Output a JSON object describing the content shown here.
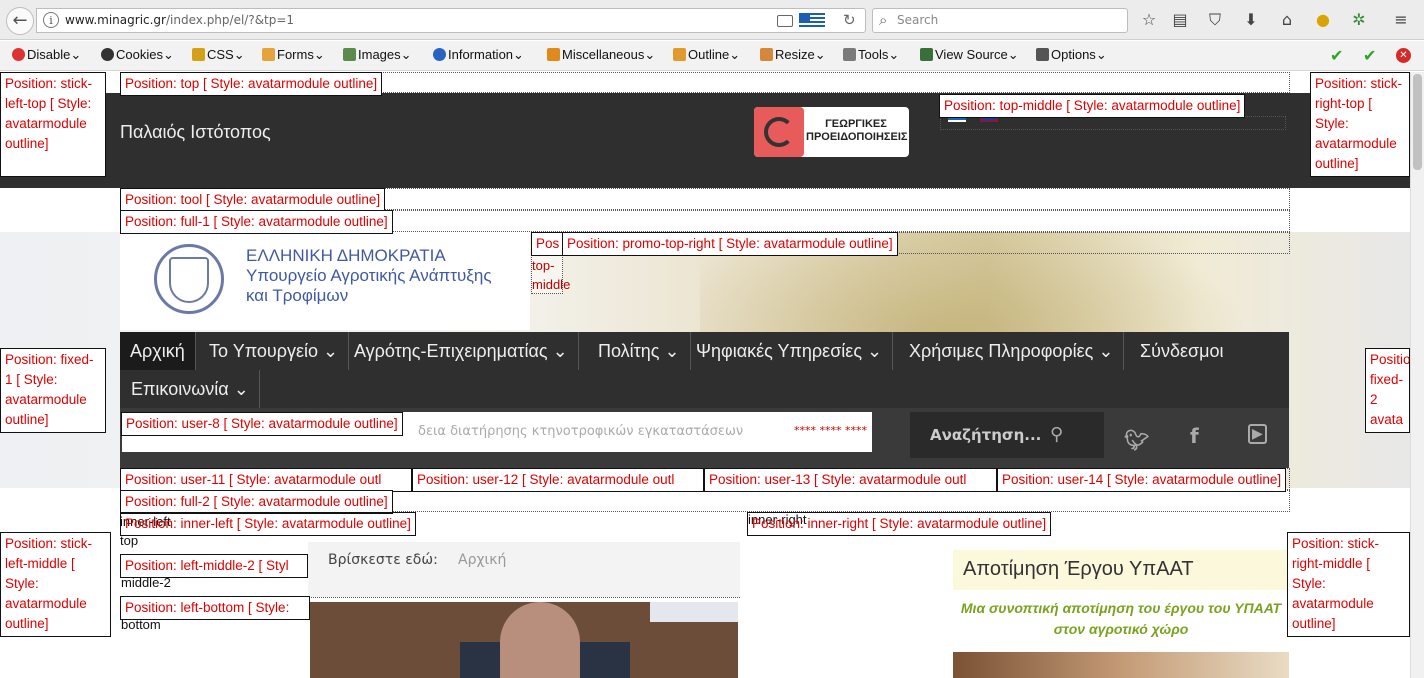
{
  "browser": {
    "url_host": "www.minagric.gr",
    "url_path": "/index.php/el/?&tp=1",
    "search_placeholder": "Search",
    "icons": [
      "back-icon",
      "info-icon",
      "reader-view-icon",
      "flag-greece-icon",
      "reload-icon",
      "search-icon",
      "bookmark-star-icon",
      "library-icon",
      "pocket-icon",
      "download-icon",
      "home-icon",
      "extension-icon",
      "extension-2-icon",
      "menu-icon"
    ]
  },
  "devbar": {
    "items": [
      "Disable",
      "Cookies",
      "CSS",
      "Forms",
      "Images",
      "Information",
      "Miscellaneous",
      "Outline",
      "Resize",
      "Tools",
      "View Source",
      "Options"
    ]
  },
  "outlines": {
    "stick_left_top": "Position: stick-left-top [ Style: avatarmodule outline]",
    "top": "Position: top [ Style: avatarmodule outline]",
    "top_middle": "Position: top-middle [ Style: avatarmodule outline]",
    "stick_right_top": "Position: stick-right-top [ Style: avatarmodule outline]",
    "tool": "Position: tool [ Style: avatarmodule outline]",
    "full_1": "Position: full-1 [ Style: avatarmodule outline]",
    "promo_top_middle_partial": "Pos",
    "promo_top_middle_rest": "top-middle",
    "promo_top_right": "Position: promo-top-right [ Style: avatarmodule outline]",
    "fixed_1": "Position: fixed-1 [ Style: avatarmodule outline]",
    "fixed_2": "Positio fixed-2 avata outlin",
    "user_8": "Position: user-8 [ Style: avatarmodule outline]",
    "user_11": "Position: user-11 [ Style: avatarmodule outl",
    "user_12": "Position: user-12 [ Style: avatarmodule outl",
    "user_13": "Position: user-13 [ Style: avatarmodule outl",
    "user_14": "Position: user-14 [ Style: avatarmodule outline]",
    "full_2": "Position: full-2 [ Style: avatarmodule outline]",
    "inner_left": "Position: inner-left [ Style: avatarmodule outline]",
    "inner_left_top": "inner-left top",
    "inner_right": "Position: inner-right [ Style: avatarmodule outline]",
    "inner_right_top": "inner-right",
    "stick_left_middle": "Position: stick-left-middle [ Style: avatarmodule outline]",
    "left_middle_2": "Position: left-middle-2 [ Styl",
    "middle_2": "middle-2",
    "left_bottom": "Position: left-bottom [ Style:",
    "bottom": "bottom",
    "stick_right_middle": "Position: stick-right-middle [ Style: avatarmodule outline]"
  },
  "page": {
    "old_site": "Παλαιός Ιστότοπος",
    "warning_logo": "ΓΕΩΡΓΙΚΕΣ ΠΡΟΕΙΔΟΠΟΙΗΣΕΙΣ",
    "ministry_lines": [
      "ΕΛΛΗΝΙΚΗ ΔΗΜΟΚΡΑΤΙΑ",
      "Υπουργείο Αγροτικής Ανάπτυξης",
      "και Τροφίμων"
    ],
    "nav": [
      "Αρχική",
      "Το Υπουργείο",
      "Αγρότης-Επιχειρηματίας",
      "Πολίτης",
      "Ψηφιακές Υπηρεσίες",
      "Χρήσιμες Πληροφορίες",
      "Σύνδεσμοι",
      "Επικοινωνία"
    ],
    "ticker": "δεια διατήρησης κτηνοτροφικών εγκαταστάσεων",
    "ticker_stars": "**** **** ****",
    "site_search": "Αναζήτηση...",
    "breadcrumb_label": "Βρίσκεστε εδώ:",
    "breadcrumb_home": "Αρχική",
    "promo_title": "Αποτίμηση Έργου ΥπΑΑΤ",
    "promo_sub": "Μια συνοπτική αποτίμηση του έργου του ΥΠΑΑΤ στον αγροτικό χώρο",
    "social": [
      "twitter-icon",
      "facebook-icon",
      "youtube-icon"
    ]
  }
}
